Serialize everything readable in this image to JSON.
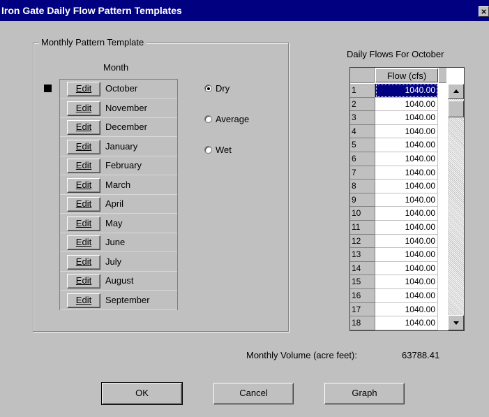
{
  "window": {
    "title": "Iron Gate Daily Flow Pattern Templates",
    "close_label": "×"
  },
  "group": {
    "legend": "Monthly Pattern Template",
    "month_header": "Month",
    "edit_label": "Edit"
  },
  "months": [
    "October",
    "November",
    "December",
    "January",
    "February",
    "March",
    "April",
    "May",
    "June",
    "July",
    "August",
    "September"
  ],
  "selected_month": "October",
  "radios": [
    {
      "label": "Dry",
      "checked": true
    },
    {
      "label": "Average",
      "checked": false
    },
    {
      "label": "Wet",
      "checked": false
    }
  ],
  "grid": {
    "title": "Daily Flows For October",
    "column_header": "Flow (cfs)",
    "rows": [
      {
        "day": "1",
        "flow": "1040.00"
      },
      {
        "day": "2",
        "flow": "1040.00"
      },
      {
        "day": "3",
        "flow": "1040.00"
      },
      {
        "day": "4",
        "flow": "1040.00"
      },
      {
        "day": "5",
        "flow": "1040.00"
      },
      {
        "day": "6",
        "flow": "1040.00"
      },
      {
        "day": "7",
        "flow": "1040.00"
      },
      {
        "day": "8",
        "flow": "1040.00"
      },
      {
        "day": "9",
        "flow": "1040.00"
      },
      {
        "day": "10",
        "flow": "1040.00"
      },
      {
        "day": "11",
        "flow": "1040.00"
      },
      {
        "day": "12",
        "flow": "1040.00"
      },
      {
        "day": "13",
        "flow": "1040.00"
      },
      {
        "day": "14",
        "flow": "1040.00"
      },
      {
        "day": "15",
        "flow": "1040.00"
      },
      {
        "day": "16",
        "flow": "1040.00"
      },
      {
        "day": "17",
        "flow": "1040.00"
      },
      {
        "day": "18",
        "flow": "1040.00"
      }
    ]
  },
  "volume": {
    "label": "Monthly Volume (acre feet):",
    "value": "63788.41"
  },
  "buttons": {
    "ok": "OK",
    "cancel": "Cancel",
    "graph": "Graph"
  }
}
